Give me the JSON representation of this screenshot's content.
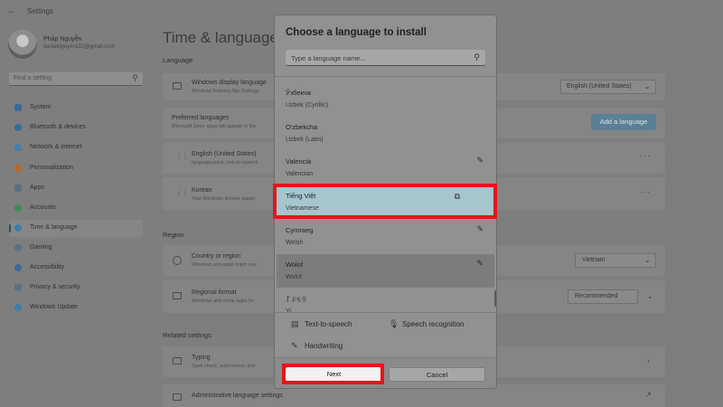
{
  "window": {
    "title": "Settings",
    "back_icon": "back-arrow-icon"
  },
  "profile": {
    "name": "Pháp Nguyễn",
    "email": "danielnguyen112@gmail.com"
  },
  "search": {
    "placeholder": "Find a setting"
  },
  "nav": {
    "items": [
      {
        "label": "System",
        "color": "#3a6c9c",
        "active": false
      },
      {
        "label": "Bluetooth & devices",
        "color": "#2f6f9e",
        "active": false
      },
      {
        "label": "Network & internet",
        "color": "#4a7ea8",
        "active": false
      },
      {
        "label": "Personalization",
        "color": "#b06a35",
        "active": false
      },
      {
        "label": "Apps",
        "color": "#5e6f82",
        "active": false
      },
      {
        "label": "Accounts",
        "color": "#3b8a5e",
        "active": false
      },
      {
        "label": "Time & language",
        "color": "#3a7fb0",
        "active": true
      },
      {
        "label": "Gaming",
        "color": "#5e6f82",
        "active": false
      },
      {
        "label": "Accessibility",
        "color": "#3a6c9c",
        "active": false
      },
      {
        "label": "Privacy & security",
        "color": "#5e6f82",
        "active": false
      },
      {
        "label": "Windows Update",
        "color": "#3a7fb0",
        "active": false
      }
    ]
  },
  "main": {
    "title": "Time & language",
    "section_language": "Language",
    "display_language": {
      "title": "Windows display language",
      "subtitle": "Windows features like Settings",
      "value": "English (United States)"
    },
    "preferred": {
      "title": "Preferred languages",
      "subtitle": "Microsoft Store apps will appear in the",
      "add_button": "Add a language"
    },
    "lang_english": {
      "title": "English (United States)",
      "subtitle": "language pack, text-to-speech"
    },
    "lang_korean": {
      "title": "Korean",
      "subtitle": "Your Windows license suppo"
    },
    "section_region": "Region",
    "country": {
      "title": "Country or region",
      "subtitle": "Windows and apps might use",
      "value": "Vietnam"
    },
    "regional_format": {
      "title": "Regional format",
      "subtitle": "Windows and some apps for",
      "value": "Recommended"
    },
    "section_related": "Related settings",
    "typing": {
      "title": "Typing",
      "subtitle": "Spell check, autocorrect, text"
    },
    "admin": {
      "title": "Administrative language settings"
    }
  },
  "dialog": {
    "title": "Choose a language to install",
    "search_placeholder": "Type a language name...",
    "languages": [
      {
        "native": "Ўзбекча",
        "english": "Uzbek (Cyrillic)",
        "feature_icon": ""
      },
      {
        "native": "O'zbekcha",
        "english": "Uzbek (Latin)",
        "feature_icon": ""
      },
      {
        "native": "Valencià",
        "english": "Valencian",
        "feature_icon": "handwriting-icon"
      },
      {
        "native": "Tiếng Việt",
        "english": "Vietnamese",
        "feature_icon": "display-language-icon"
      },
      {
        "native": "Cymraeg",
        "english": "Welsh",
        "feature_icon": "handwriting-icon"
      },
      {
        "native": "Wolof",
        "english": "Wolof",
        "feature_icon": "handwriting-icon"
      },
      {
        "native": "ꆈꌠꁱꂷ",
        "english": "Yi",
        "feature_icon": ""
      }
    ],
    "features": {
      "tts": "Text-to-speech",
      "speech": "Speech recognition",
      "handwriting": "Handwriting"
    },
    "next_label": "Next",
    "cancel_label": "Cancel"
  },
  "colors": {
    "highlight": "#e3161b",
    "selected_row": "#a5c6cd",
    "accent": "#5b7f95"
  }
}
